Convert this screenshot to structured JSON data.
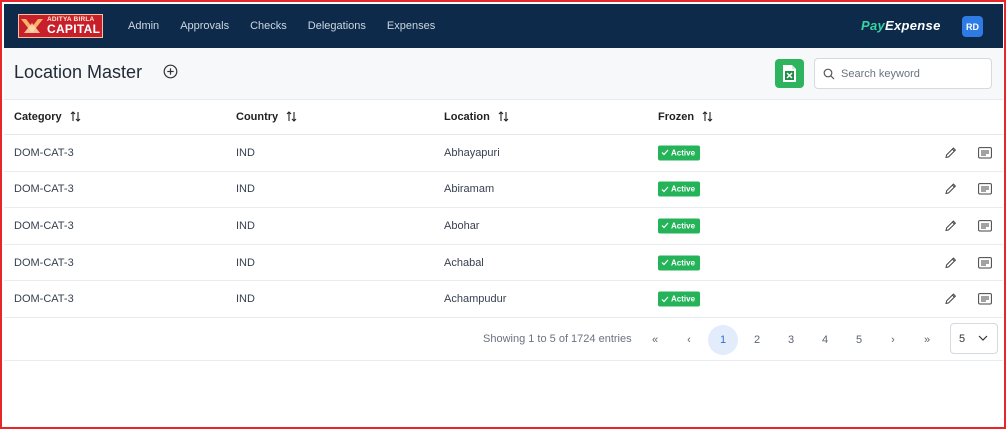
{
  "logo": {
    "line1": "ADITYA BIRLA",
    "line2": "CAPITAL",
    "color": "#c8202a"
  },
  "nav": [
    {
      "label": "Admin"
    },
    {
      "label": "Approvals"
    },
    {
      "label": "Checks"
    },
    {
      "label": "Delegations"
    },
    {
      "label": "Expenses"
    }
  ],
  "brand": {
    "part1": "Pay",
    "part2": "Expense"
  },
  "user": {
    "initials": "RD"
  },
  "page": {
    "title": "Location Master"
  },
  "search": {
    "placeholder": "Search keyword",
    "value": ""
  },
  "table": {
    "headers": [
      "Category",
      "Country",
      "Location",
      "Frozen"
    ],
    "rows": [
      {
        "category": "DOM-CAT-3",
        "country": "IND",
        "location": "Abhayapuri",
        "status": "Active"
      },
      {
        "category": "DOM-CAT-3",
        "country": "IND",
        "location": "Abiramam",
        "status": "Active"
      },
      {
        "category": "DOM-CAT-3",
        "country": "IND",
        "location": "Abohar",
        "status": "Active"
      },
      {
        "category": "DOM-CAT-3",
        "country": "IND",
        "location": "Achabal",
        "status": "Active"
      },
      {
        "category": "DOM-CAT-3",
        "country": "IND",
        "location": "Achampudur",
        "status": "Active"
      }
    ]
  },
  "pagination": {
    "summary": "Showing 1 to 5 of 1724 entries",
    "pages": [
      "1",
      "2",
      "3",
      "4",
      "5"
    ],
    "current": "1",
    "first": "«",
    "prev": "‹",
    "next": "›",
    "last": "»",
    "per_page": "5"
  },
  "colors": {
    "nav_bg": "#0d2a4a",
    "accent": "#2eb45e",
    "badge": "#25b35a",
    "border": "#e5262b"
  }
}
